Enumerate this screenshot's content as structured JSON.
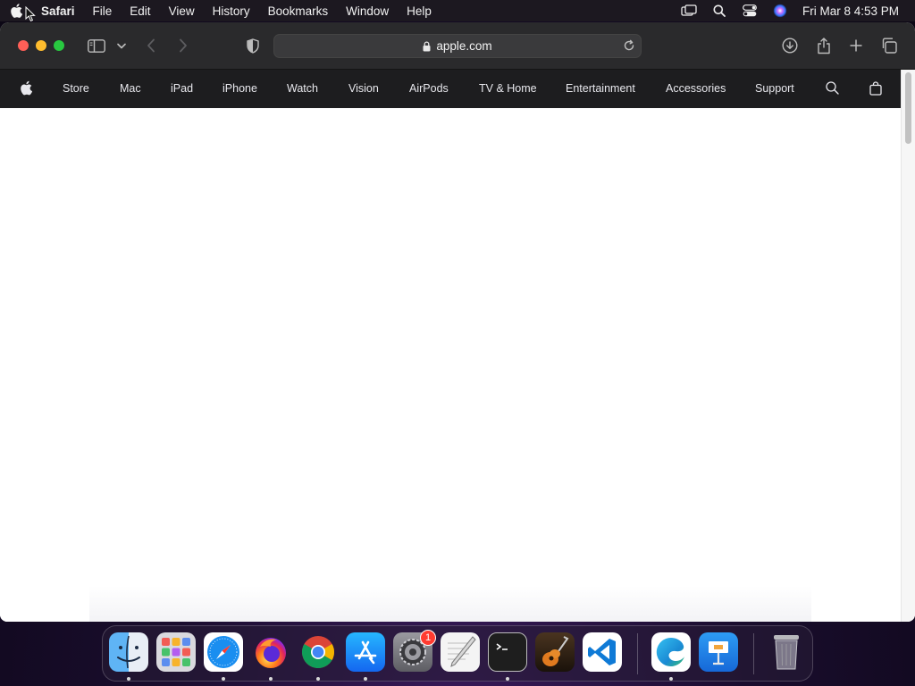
{
  "menubar": {
    "app_name": "Safari",
    "items": [
      "File",
      "Edit",
      "View",
      "History",
      "Bookmarks",
      "Window",
      "Help"
    ],
    "clock": "Fri Mar 8  4:53 PM",
    "status_icons": [
      "screen-mirroring-icon",
      "spotlight-search-icon",
      "control-center-icon",
      "siri-icon"
    ]
  },
  "safari": {
    "address": "apple.com",
    "toolbar_icons": [
      "sidebar-icon",
      "chevron-down-icon",
      "back-icon",
      "forward-icon",
      "privacy-shield-icon",
      "downloads-icon",
      "share-icon",
      "new-tab-icon",
      "tab-overview-icon"
    ]
  },
  "site_nav": {
    "items": [
      "Store",
      "Mac",
      "iPad",
      "iPhone",
      "Watch",
      "Vision",
      "AirPods",
      "TV & Home",
      "Entertainment",
      "Accessories",
      "Support"
    ]
  },
  "dock": {
    "apps": [
      "Finder",
      "Launchpad",
      "Safari",
      "Firefox",
      "Chrome",
      "App Store",
      "System Settings",
      "TextEdit",
      "Terminal",
      "GarageBand",
      "Visual Studio Code",
      "Microsoft Edge",
      "Keynote",
      "Trash"
    ],
    "system_settings_badge": "1"
  },
  "colors": {
    "toolbar": "#2a2a2c",
    "site_nav": "#1d1d1f",
    "close": "#ff5f57",
    "minimize": "#febc2e",
    "maximize": "#28c840"
  }
}
